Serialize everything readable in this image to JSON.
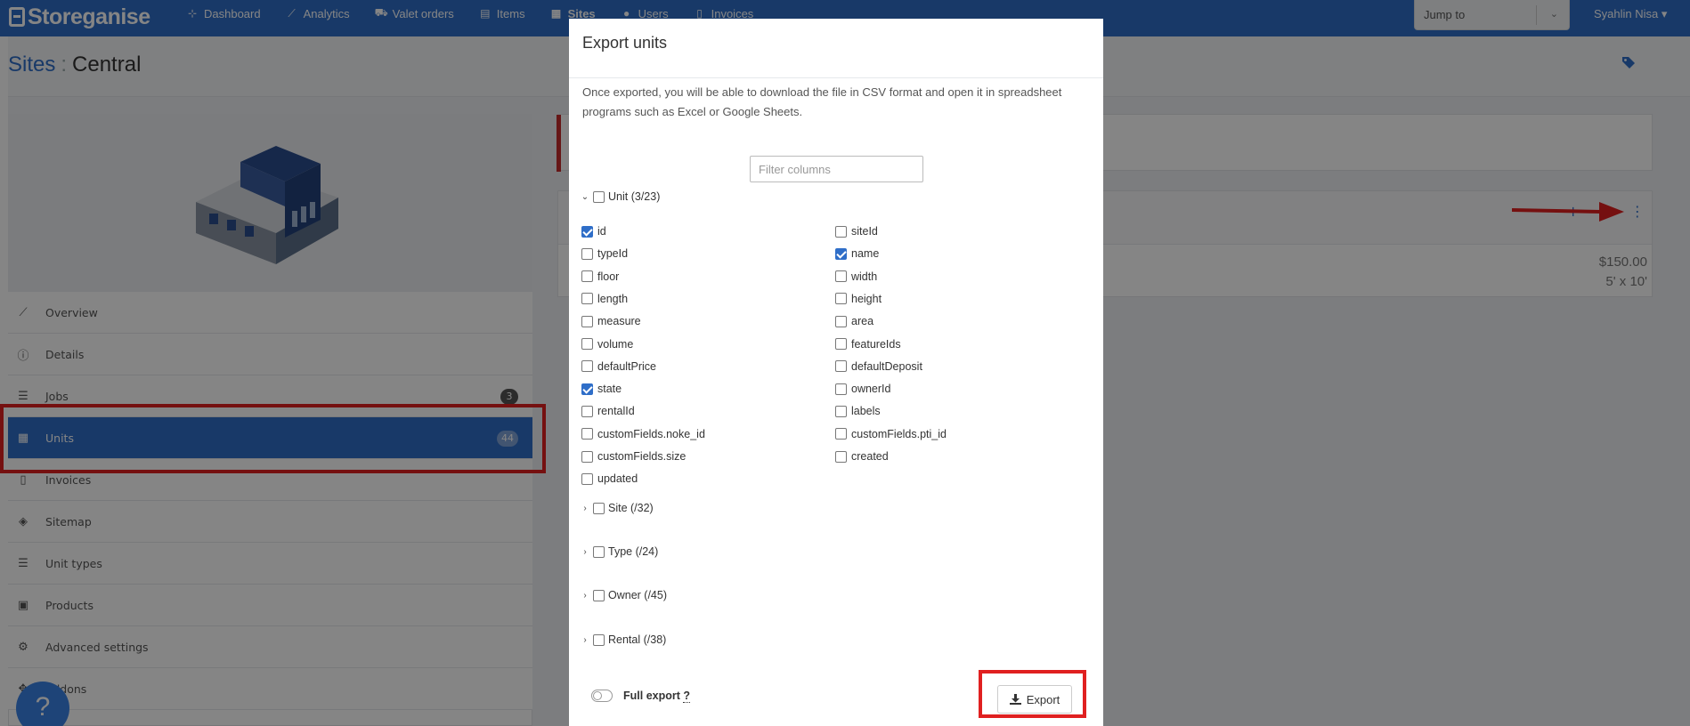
{
  "nav": {
    "brand": "Storeganise",
    "items": [
      {
        "label": "Dashboard",
        "icon": "sitemap-icon",
        "glyph": "⊹"
      },
      {
        "label": "Analytics",
        "icon": "chart-icon",
        "glyph": "⟋"
      },
      {
        "label": "Valet orders",
        "icon": "truck-icon",
        "glyph": "⛟"
      },
      {
        "label": "Items",
        "icon": "box-icon",
        "glyph": "▤"
      },
      {
        "label": "Sites",
        "icon": "building-icon",
        "glyph": "▦"
      },
      {
        "label": "Users",
        "icon": "user-icon",
        "glyph": "●"
      },
      {
        "label": "Invoices",
        "icon": "file-icon",
        "glyph": "▯"
      }
    ],
    "jump_to": "Jump to",
    "user": "Syahlin Nisa"
  },
  "page": {
    "crumb": "Sites",
    "colon": ":",
    "title": "Central"
  },
  "side_menu": [
    {
      "label": "Overview",
      "icon": "chart-line-icon",
      "glyph": "⟋",
      "badge": ""
    },
    {
      "label": "Details",
      "icon": "info-icon",
      "glyph": "ⓘ",
      "badge": ""
    },
    {
      "label": "Jobs",
      "icon": "tasks-icon",
      "glyph": "☰",
      "badge": "3"
    },
    {
      "label": "Units",
      "icon": "building-icon",
      "glyph": "▦",
      "badge": "44"
    },
    {
      "label": "Invoices",
      "icon": "invoice-icon",
      "glyph": "▯",
      "badge": ""
    },
    {
      "label": "Sitemap",
      "icon": "layers-icon",
      "glyph": "◈",
      "badge": ""
    },
    {
      "label": "Unit types",
      "icon": "list-icon",
      "glyph": "☰",
      "badge": ""
    },
    {
      "label": "Products",
      "icon": "boxes-icon",
      "glyph": "▣",
      "badge": ""
    },
    {
      "label": "Advanced settings",
      "icon": "gear-icon",
      "glyph": "⚙",
      "badge": ""
    },
    {
      "label": "Addons",
      "icon": "cogs-icon",
      "glyph": "✥",
      "badge": ""
    }
  ],
  "unit_price": "$150.00",
  "unit_size": "5' x 10'",
  "help_label": "?",
  "modal": {
    "title": "Export units",
    "description": "Once exported, you will be able to download the file in CSV format and open it in spreadsheet programs such as Excel or Google Sheets.",
    "filter_placeholder": "Filter columns",
    "unit_group": "Unit (3/23)",
    "unit_fields": [
      {
        "label": "id",
        "checked": true
      },
      {
        "label": "siteId",
        "checked": false
      },
      {
        "label": "typeId",
        "checked": false
      },
      {
        "label": "name",
        "checked": true
      },
      {
        "label": "floor",
        "checked": false
      },
      {
        "label": "width",
        "checked": false
      },
      {
        "label": "length",
        "checked": false
      },
      {
        "label": "height",
        "checked": false
      },
      {
        "label": "measure",
        "checked": false
      },
      {
        "label": "area",
        "checked": false
      },
      {
        "label": "volume",
        "checked": false
      },
      {
        "label": "featureIds",
        "checked": false
      },
      {
        "label": "defaultPrice",
        "checked": false
      },
      {
        "label": "defaultDeposit",
        "checked": false
      },
      {
        "label": "state",
        "checked": true
      },
      {
        "label": "ownerId",
        "checked": false
      },
      {
        "label": "rentalId",
        "checked": false
      },
      {
        "label": "labels",
        "checked": false
      },
      {
        "label": "customFields.noke_id",
        "checked": false
      },
      {
        "label": "customFields.pti_id",
        "checked": false
      },
      {
        "label": "customFields.size",
        "checked": false
      },
      {
        "label": "created",
        "checked": false
      },
      {
        "label": "updated",
        "checked": false
      }
    ],
    "groups": [
      {
        "label": "Site (/32)"
      },
      {
        "label": "Type (/24)"
      },
      {
        "label": "Owner (/45)"
      },
      {
        "label": "Rental (/38)"
      }
    ],
    "full_export_label": "Full export",
    "full_export_help": "?",
    "export_label": "Export"
  },
  "colors": {
    "accent": "#2f6ec8",
    "highlight": "#e02020"
  }
}
